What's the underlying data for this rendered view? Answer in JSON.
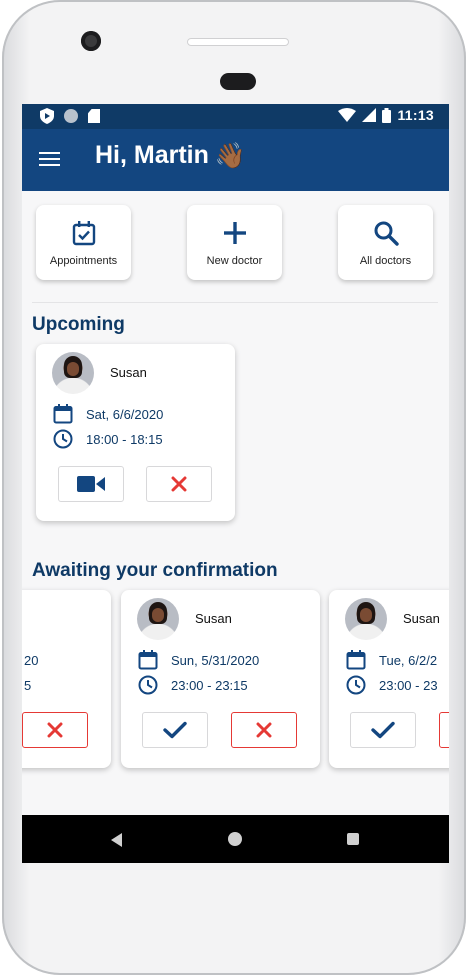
{
  "status_bar": {
    "time": "11:13",
    "icons": [
      "shield-icon",
      "circle-icon",
      "sd-card-icon",
      "wifi-icon",
      "signal-icon",
      "battery-icon"
    ]
  },
  "header": {
    "greeting": "Hi,  Martin",
    "emoji": "👋🏾"
  },
  "quick_actions": [
    {
      "label": "Appointments",
      "icon": "calendar-check-icon"
    },
    {
      "label": "New doctor",
      "icon": "plus-icon"
    },
    {
      "label": "All doctors",
      "icon": "search-icon"
    }
  ],
  "upcoming": {
    "title": "Upcoming",
    "items": [
      {
        "name": "Susan",
        "date": "Sat, 6/6/2020",
        "time": "18:00 - 18:15"
      }
    ]
  },
  "awaiting": {
    "title": "Awaiting your confirmation",
    "items": [
      {
        "name": "",
        "date": "20",
        "time": "5"
      },
      {
        "name": "Susan",
        "date": "Sun, 5/31/2020",
        "time": "23:00 - 23:15"
      },
      {
        "name": "Susan",
        "date": "Tue, 6/2/2",
        "time": "23:00 - 23"
      }
    ]
  },
  "colors": {
    "primary": "#134680",
    "status_bar": "#0f3a66",
    "accent_red": "#e53935",
    "text_blue": "#0f3a66"
  },
  "nav": {
    "buttons": [
      "back-icon",
      "home-icon",
      "recent-apps-icon"
    ]
  }
}
